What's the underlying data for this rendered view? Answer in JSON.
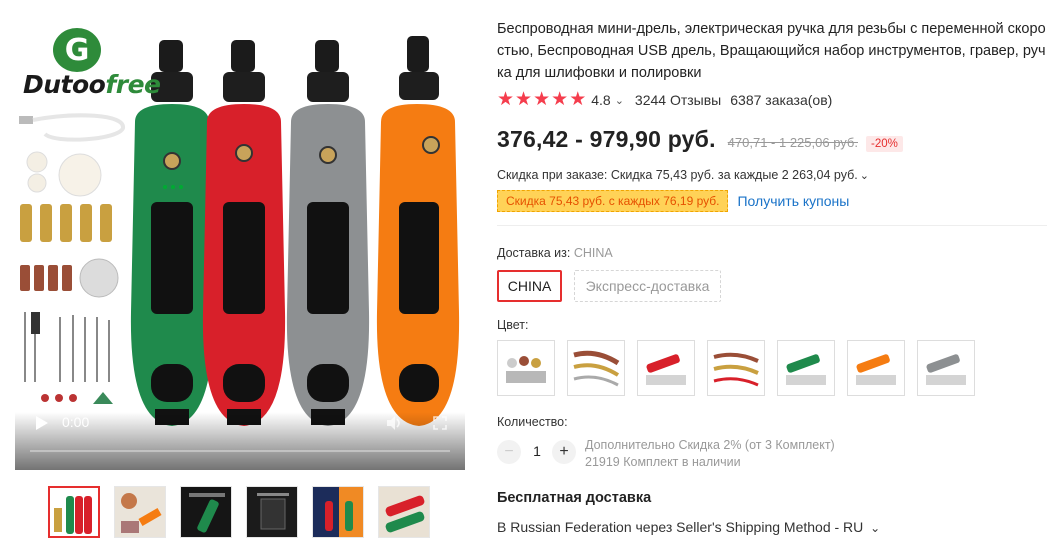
{
  "product": {
    "title": "Беспроводная мини-дрель, электрическая ручка для резьбы с переменной скоростью, Беспроводная USB дрель, Вращающийся набор инструментов, гравер, ручка для шлифовки и полировки",
    "rating": "4.8",
    "reviews": "3244 Отзывы",
    "orders": "6387 заказа(ов)",
    "price": "376,42 - 979,90 руб.",
    "old_price": "470,71 - 1 225,06 руб.",
    "discount_badge": "-20%",
    "order_discount": "Скидка при заказе: Скидка 75,43 руб. за каждые 2 263,04 руб.",
    "coupon_tag": "Скидка 75,43 руб. с каждых 76,19 руб.",
    "get_coupons": "Получить купоны"
  },
  "media": {
    "brand_dutoo": "Dutoo",
    "brand_free": "free",
    "video_time": "0:00",
    "thumbnail_count": 6
  },
  "shipping": {
    "from_label": "Доставка из:",
    "from_value": "CHINA",
    "options": [
      "CHINA",
      "Экспресс-доставка"
    ],
    "free_label": "Бесплатная доставка",
    "method": "В Russian Federation через Seller's Shipping Method - RU"
  },
  "color": {
    "label": "Цвет:",
    "swatch_count": 7
  },
  "quantity": {
    "label": "Количество:",
    "value": "1",
    "note_discount": "Дополнительно Скидка 2% (от 3 Комплект)",
    "note_stock": "21919 Комплект в наличии"
  },
  "colors": {
    "accent": "#e62e2e",
    "star": "#f53d4d",
    "link": "#1a73c8",
    "coupon_bg": "#ffd257",
    "drill_green": "#1f8a4c",
    "drill_red": "#d8202a",
    "drill_gray": "#8d9092",
    "drill_orange": "#f57c12"
  }
}
